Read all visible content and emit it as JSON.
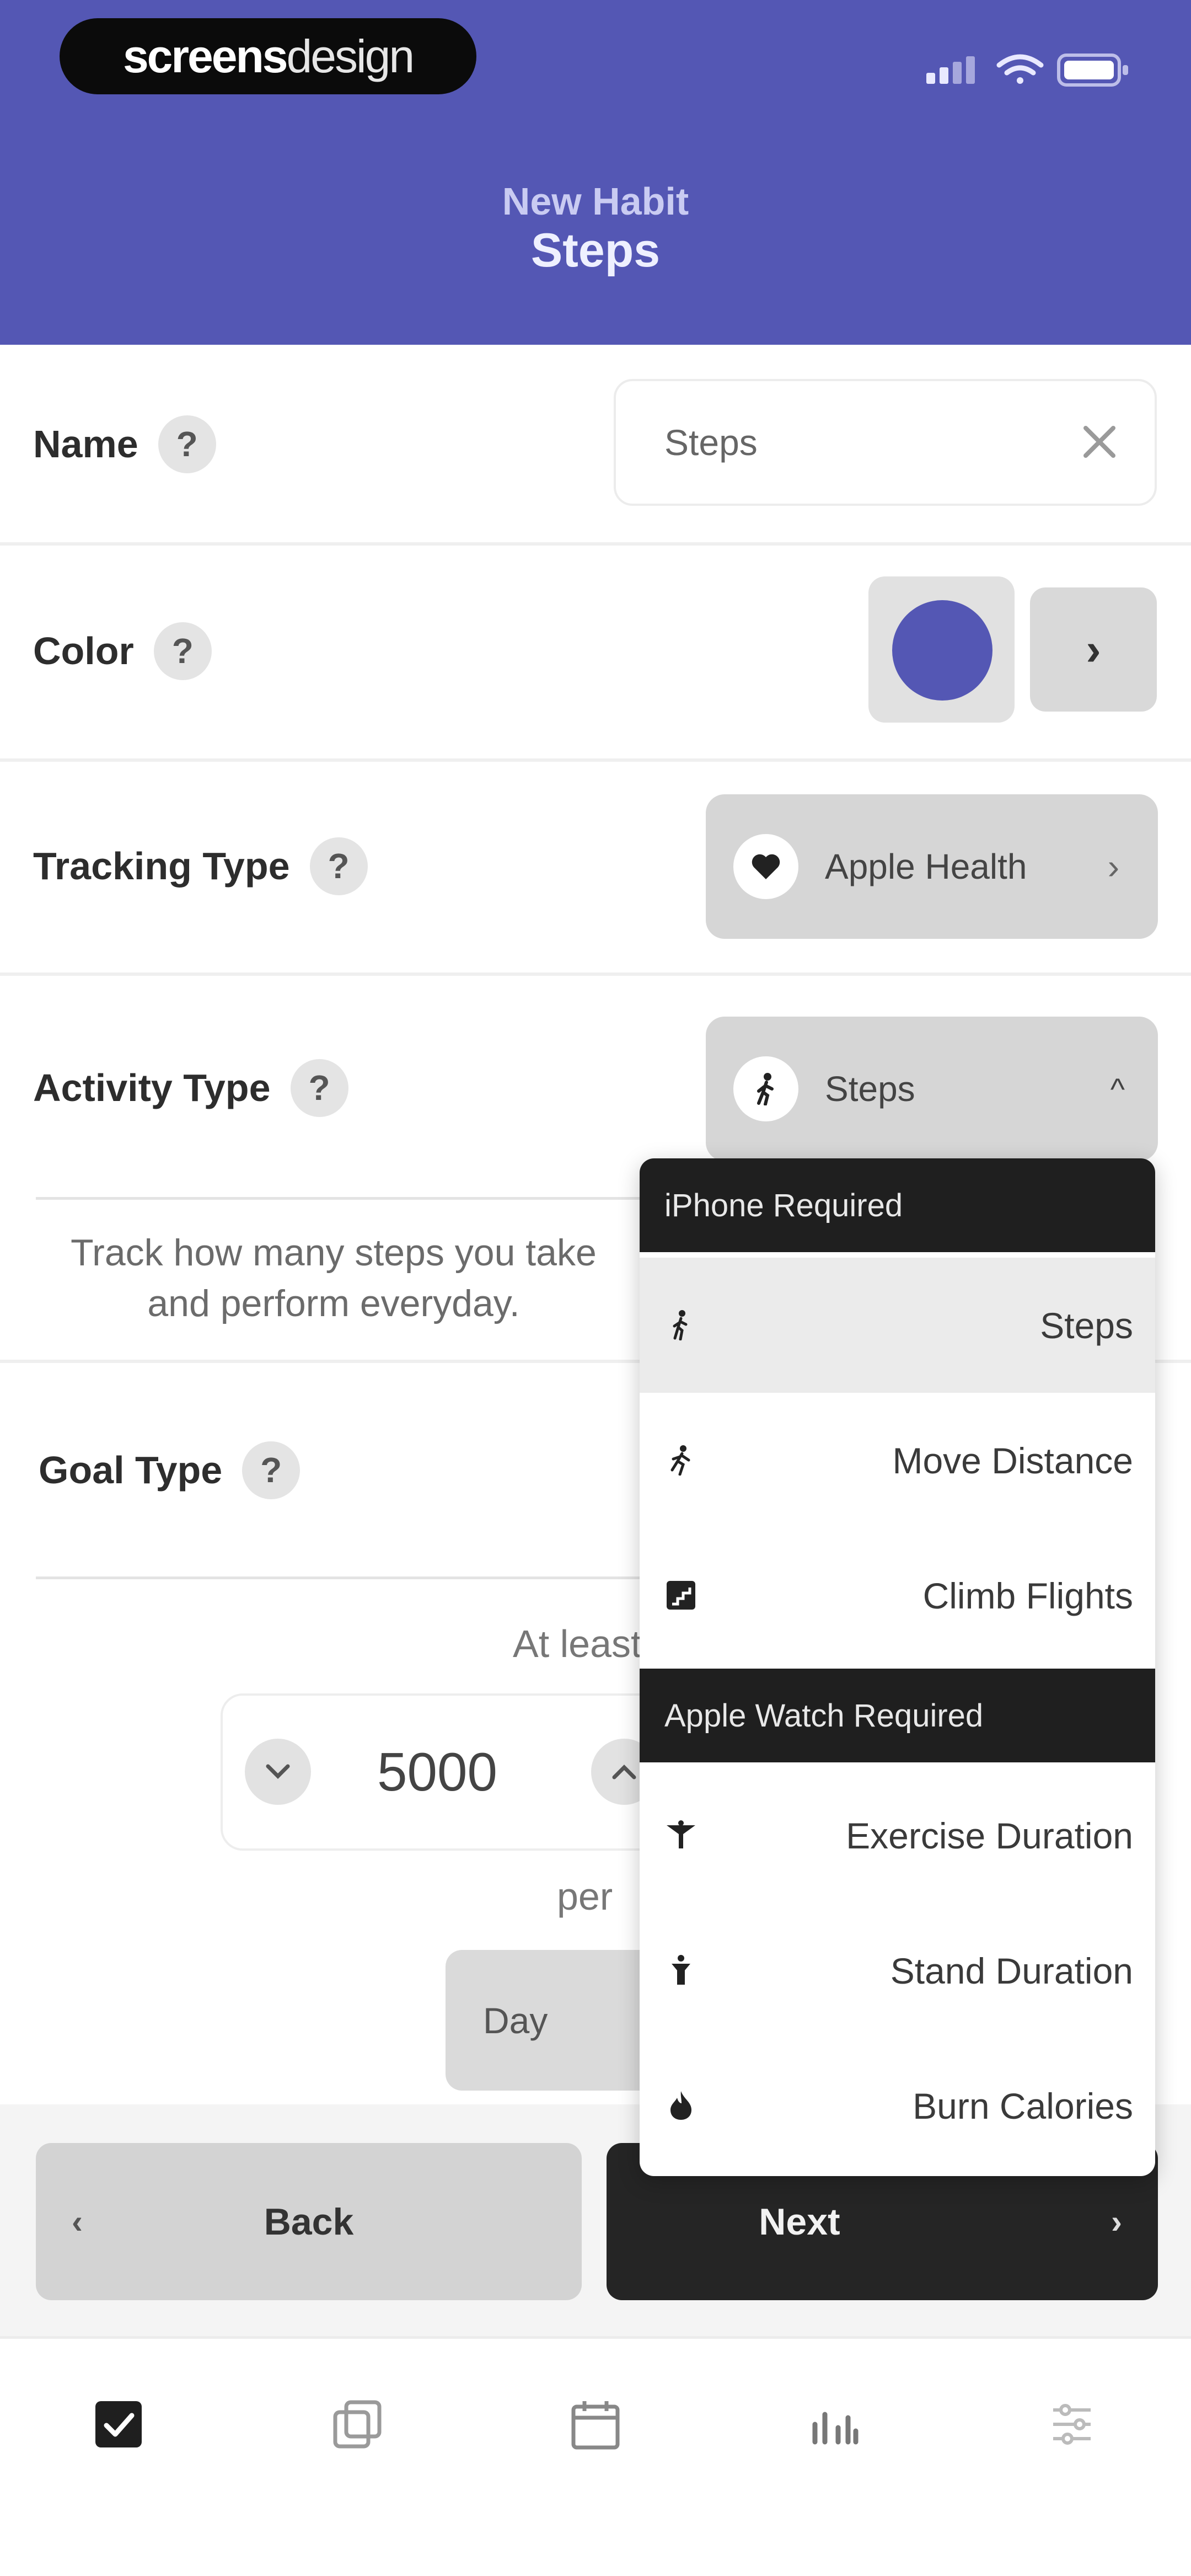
{
  "header": {
    "logo_bold": "screens",
    "logo_light": "design",
    "subtitle": "New Habit",
    "title": "Steps"
  },
  "form": {
    "name": {
      "label": "Name",
      "value": "Steps"
    },
    "color": {
      "label": "Color",
      "value": "#5457b4"
    },
    "tracking_type": {
      "label": "Tracking Type",
      "value": "Apple Health",
      "icon": "heart-icon"
    },
    "activity_type": {
      "label": "Activity Type",
      "value": "Steps",
      "icon": "walking-icon",
      "description": "Track how many steps you take and perform everyday."
    },
    "goal_type": {
      "label": "Goal Type",
      "at_least": "At least",
      "amount": "5000",
      "per": "per",
      "period": "Day"
    }
  },
  "dropdown": {
    "sections": [
      {
        "title": "iPhone Required",
        "items": [
          {
            "label": "Steps",
            "icon": "walking-icon",
            "selected": true
          },
          {
            "label": "Move Distance",
            "icon": "running-icon",
            "selected": false
          },
          {
            "label": "Climb Flights",
            "icon": "stairs-icon",
            "selected": false
          }
        ]
      },
      {
        "title": "Apple Watch Required",
        "items": [
          {
            "label": "Exercise Duration",
            "icon": "exercise-icon",
            "selected": false
          },
          {
            "label": "Stand Duration",
            "icon": "standing-icon",
            "selected": false
          },
          {
            "label": "Burn Calories",
            "icon": "flame-icon",
            "selected": false
          }
        ]
      }
    ]
  },
  "actions": {
    "back": "Back",
    "next": "Next"
  },
  "tabbar": [
    {
      "icon": "checkbox-icon",
      "active": true
    },
    {
      "icon": "cards-icon",
      "active": false
    },
    {
      "icon": "calendar-icon",
      "active": false
    },
    {
      "icon": "stats-icon",
      "active": false
    },
    {
      "icon": "settings-icon",
      "active": false
    }
  ],
  "colors": {
    "header": "#5457b4",
    "accent": "#5457b4",
    "dark": "#252525"
  }
}
